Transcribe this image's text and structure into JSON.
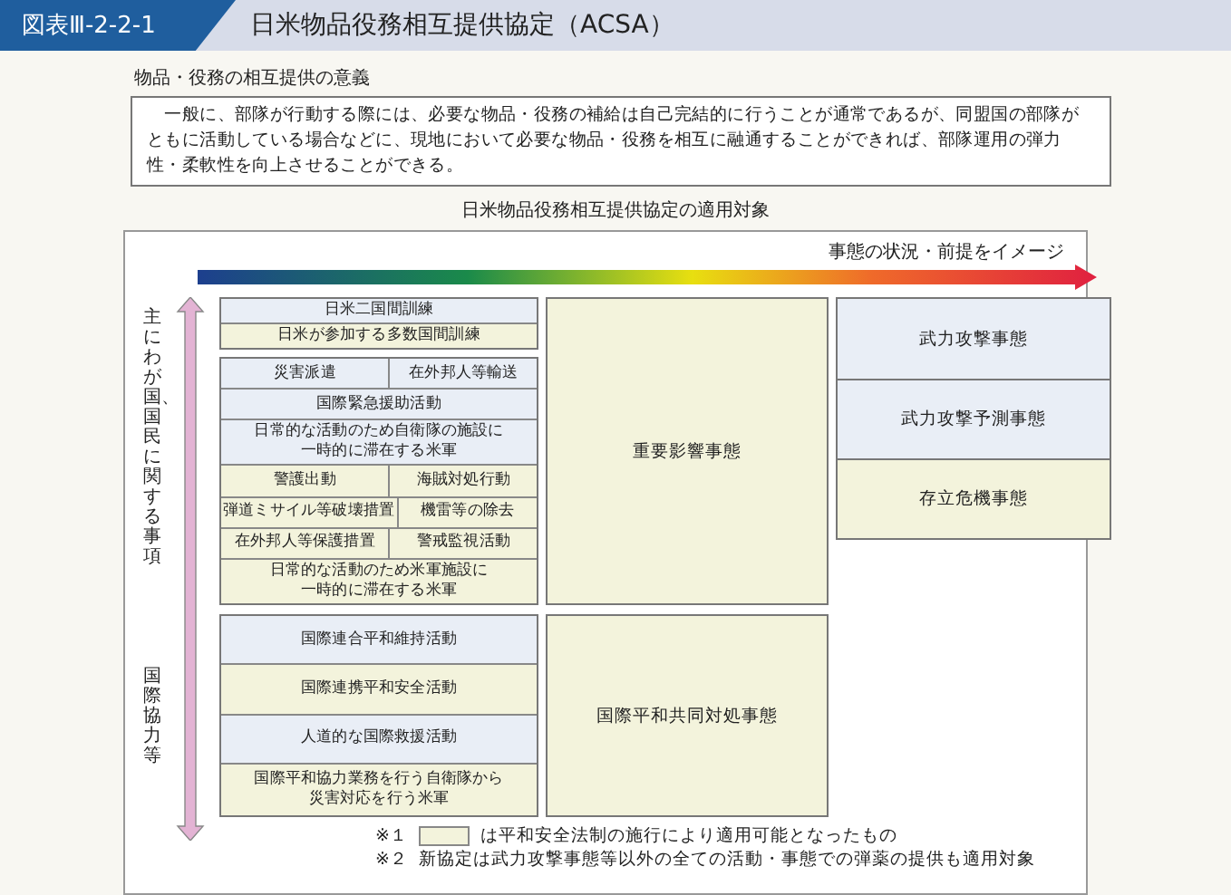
{
  "header": {
    "figure_label": "図表Ⅲ-2-2-1",
    "title": "日米物品役務相互提供協定（ACSA）"
  },
  "significance": {
    "heading": "物品・役務の相互提供の意義",
    "body": "　一般に、部隊が行動する際には、必要な物品・役務の補給は自己完結的に行うことが通常であるが、同盟国の部隊がともに活動している場合などに、現地において必要な物品・役務を相互に融通することができれば、部隊運用の弾力性・柔軟性を向上させることができる。"
  },
  "diagram": {
    "title": "日米物品役務相互提供協定の適用対象",
    "arrow_label": "事態の状況・前提をイメージ",
    "domestic": {
      "axis_label": "主にわが国、国民に関する事項",
      "groups": [
        {
          "rows": [
            {
              "cells": [
                {
                  "text": "日米二国間訓練",
                  "new": false
                }
              ]
            },
            {
              "cells": [
                {
                  "text": "日米が参加する多数国間訓練",
                  "new": true
                }
              ]
            }
          ]
        },
        {
          "rows": [
            {
              "cells": [
                {
                  "text": "災害派遣",
                  "new": false
                },
                {
                  "text": "在外邦人等輸送",
                  "new": false
                }
              ]
            },
            {
              "cells": [
                {
                  "text": "国際緊急援助活動",
                  "new": false
                }
              ]
            },
            {
              "cells": [
                {
                  "lines": [
                    "日常的な活動のため自衛隊の施設に",
                    "一時的に滞在する米軍"
                  ],
                  "new": false
                }
              ]
            },
            {
              "cells": [
                {
                  "text": "警護出動",
                  "new": true
                },
                {
                  "text": "海賊対処行動",
                  "new": true
                }
              ]
            },
            {
              "cells": [
                {
                  "text": "弾道ミサイル等破壊措置",
                  "new": true
                },
                {
                  "text": "機雷等の除去",
                  "new": true
                }
              ]
            },
            {
              "cells": [
                {
                  "text": "在外邦人等保護措置",
                  "new": true
                },
                {
                  "text": "警戒監視活動",
                  "new": true
                }
              ]
            },
            {
              "cells": [
                {
                  "lines": [
                    "日常的な活動のため米軍施設に",
                    "一時的に滞在する米軍"
                  ],
                  "new": true
                }
              ]
            }
          ]
        }
      ],
      "situation": {
        "text": "重要影響事態",
        "new": true
      },
      "armed": [
        {
          "text": "武力攻撃事態",
          "new": false
        },
        {
          "text": "武力攻撃予測事態",
          "new": false
        },
        {
          "text": "存立危機事態",
          "new": true
        }
      ]
    },
    "international": {
      "axis_label": "国際協力等",
      "rows": [
        {
          "text": "国際連合平和維持活動",
          "new": false
        },
        {
          "text": "国際連携平和安全活動",
          "new": true
        },
        {
          "text": "人道的な国際救援活動",
          "new": false
        },
        {
          "lines": [
            "国際平和協力業務を行う自衛隊から",
            "災害対応を行う米軍"
          ],
          "new": true
        }
      ],
      "situation": {
        "text": "国際平和共同対処事態",
        "new": true
      }
    },
    "notes": [
      {
        "mark": "※１",
        "text": "は平和安全法制の施行により適用可能となったもの",
        "swatch": true
      },
      {
        "mark": "※２",
        "text": "新協定は武力攻撃事態等以外の全ての活動・事態での弾薬の提供も適用対象",
        "swatch": false
      }
    ]
  }
}
